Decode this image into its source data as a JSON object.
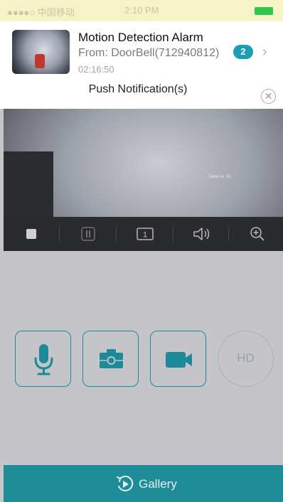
{
  "status_bar": {
    "carrier": "●●●●○ 中国移动",
    "time": "2:10 PM"
  },
  "notification": {
    "title": "Motion Detection Alarm",
    "from": "From: DoorBell(712940812)",
    "badge": "2",
    "time": "02:16:50",
    "heading": "Push Notification(s)"
  },
  "video": {
    "camera_label": "Camera 01"
  },
  "controls": [
    {
      "name": "stop-icon"
    },
    {
      "name": "pause-icon"
    },
    {
      "name": "channel-1-icon",
      "label": "1"
    },
    {
      "name": "speaker-icon"
    },
    {
      "name": "zoom-in-icon"
    }
  ],
  "buttons": {
    "hd": "HD"
  },
  "gallery": {
    "label": "Gallery"
  },
  "colors": {
    "accent": "#1e8c99",
    "badge": "#1b9fb0",
    "battery": "#2ec94a"
  }
}
